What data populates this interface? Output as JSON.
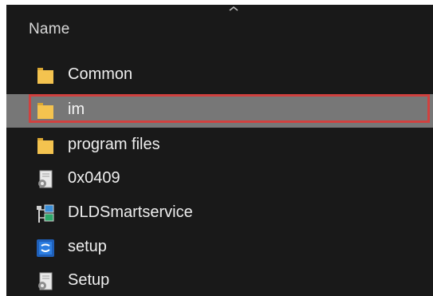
{
  "header": {
    "column_label": "Name"
  },
  "files": [
    {
      "name": "Common",
      "icon": "folder-icon",
      "selected": false
    },
    {
      "name": "im",
      "icon": "folder-icon",
      "selected": true
    },
    {
      "name": "program files",
      "icon": "folder-icon",
      "selected": false
    },
    {
      "name": "0x0409",
      "icon": "settings-file-icon",
      "selected": false
    },
    {
      "name": "DLDSmartservice",
      "icon": "network-app-icon",
      "selected": false
    },
    {
      "name": "setup",
      "icon": "setup-app-icon",
      "selected": false
    },
    {
      "name": "Setup",
      "icon": "settings-file-icon",
      "selected": false
    }
  ],
  "colors": {
    "background": "#191919",
    "selection": "#777777",
    "highlight_border": "#d0413f",
    "folder": "#f4c34f"
  }
}
